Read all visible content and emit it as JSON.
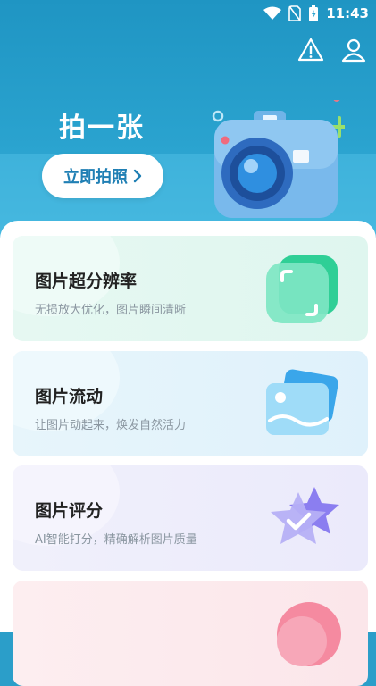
{
  "status_bar": {
    "time": "11:43"
  },
  "hero": {
    "title": "拍一张",
    "button_label": "立即拍照"
  },
  "cards": [
    {
      "title": "图片超分辨率",
      "subtitle": "无损放大优化，图片瞬间清晰",
      "icon": "crop-scan-icon"
    },
    {
      "title": "图片流动",
      "subtitle": "让图片动起来，焕发自然活力",
      "icon": "image-flow-icon"
    },
    {
      "title": "图片评分",
      "subtitle": "AI智能打分，精确解析图片质量",
      "icon": "star-check-icon"
    },
    {
      "title": "",
      "subtitle": "",
      "icon": "pink-art-icon"
    }
  ],
  "colors": {
    "hero_bg": "#1f95c3",
    "button_text": "#1f7fb4",
    "accent_green": "#3fd3a3",
    "accent_blue": "#47b6ea",
    "accent_purple": "#8b7ef0"
  }
}
